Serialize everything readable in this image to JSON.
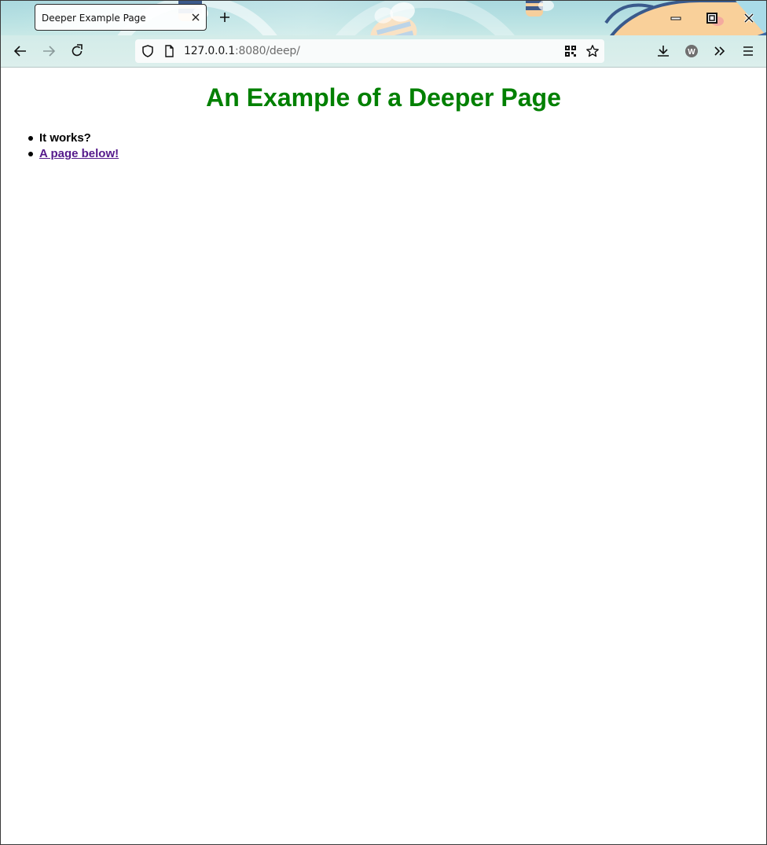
{
  "browser": {
    "tab": {
      "title": "Deeper Example Page"
    },
    "url": {
      "host": "127.0.0.1",
      "rest": ":8080/deep/"
    },
    "icons": {
      "tab_close": "close-icon",
      "new_tab": "plus-icon",
      "minimize": "minimize-icon",
      "maximize": "restore-icon",
      "close_window": "close-icon",
      "back": "arrow-left-icon",
      "forward": "arrow-right-icon",
      "reload": "reload-icon",
      "tracking_protection": "shield-icon",
      "page_info": "page-icon",
      "qr_code": "qr-code-icon",
      "bookmark": "star-icon",
      "downloads": "download-icon",
      "account": "account-icon",
      "overflow": "chevron-double-right-icon",
      "menu": "hamburger-menu-icon"
    },
    "account_letter": "W"
  },
  "page": {
    "heading": "An Example of a Deeper Page",
    "heading_color": "#008000",
    "items": [
      {
        "text": "It works?",
        "is_link": false
      },
      {
        "text": "A page below!",
        "is_link": true,
        "color": "#551a8b"
      }
    ]
  }
}
